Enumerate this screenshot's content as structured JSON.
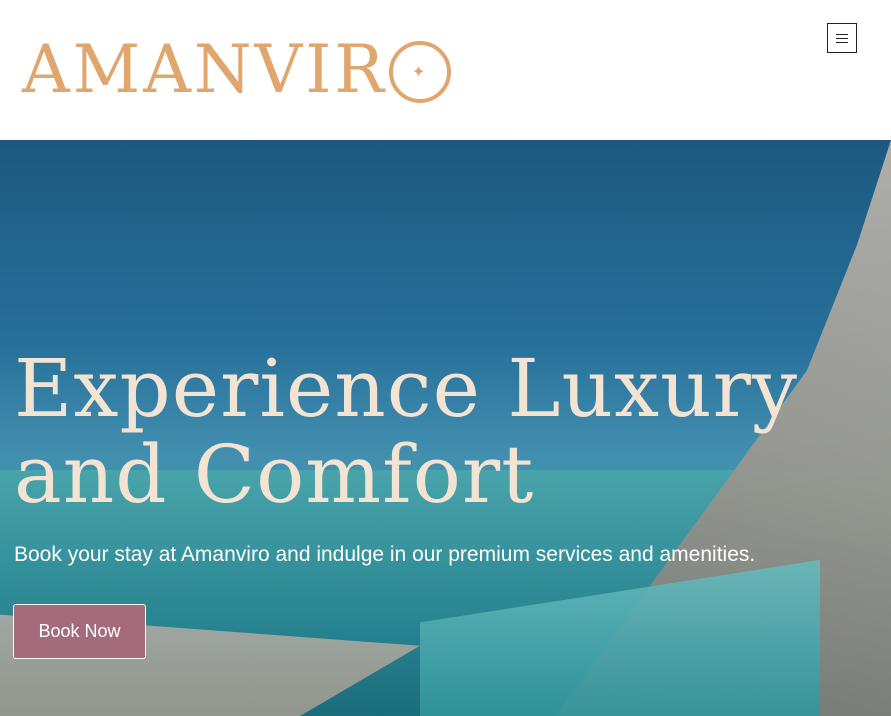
{
  "header": {
    "logo_text": "AMANVIR",
    "logo_last_letter": "O",
    "logo_star": "✦",
    "logo_color": "#e0a66e",
    "menu_icon": "hamburger-menu-icon"
  },
  "hero": {
    "title": "Experience Luxury and Comfort",
    "subtitle": "Book your stay at Amanviro and indulge in our premium services and amenities.",
    "cta_label": "Book Now",
    "cta_color": "#a46b7b",
    "title_color": "#f3e3d3"
  }
}
